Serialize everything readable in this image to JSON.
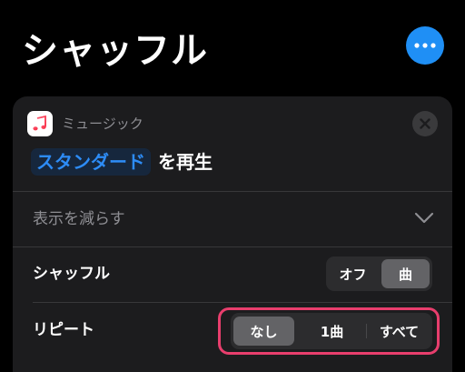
{
  "header": {
    "title": "シャッフル",
    "more_icon": "ellipsis-icon",
    "accent_color": "#1f8ff5"
  },
  "action_card": {
    "app_name": "ミュージック",
    "app_icon": "music-note-icon",
    "close_icon": "close-x-icon",
    "parameter": "スタンダード",
    "action_verb": "を再生",
    "show_less": "表示を減らす",
    "expand_icon": "chevron-down-icon",
    "shuffle": {
      "label": "シャッフル",
      "options": [
        "オフ",
        "曲"
      ],
      "selected": "曲"
    },
    "repeat": {
      "label": "リピート",
      "options": [
        "なし",
        "1曲",
        "すべて"
      ],
      "selected": "なし",
      "highlight_color": "#e83e6d"
    }
  }
}
